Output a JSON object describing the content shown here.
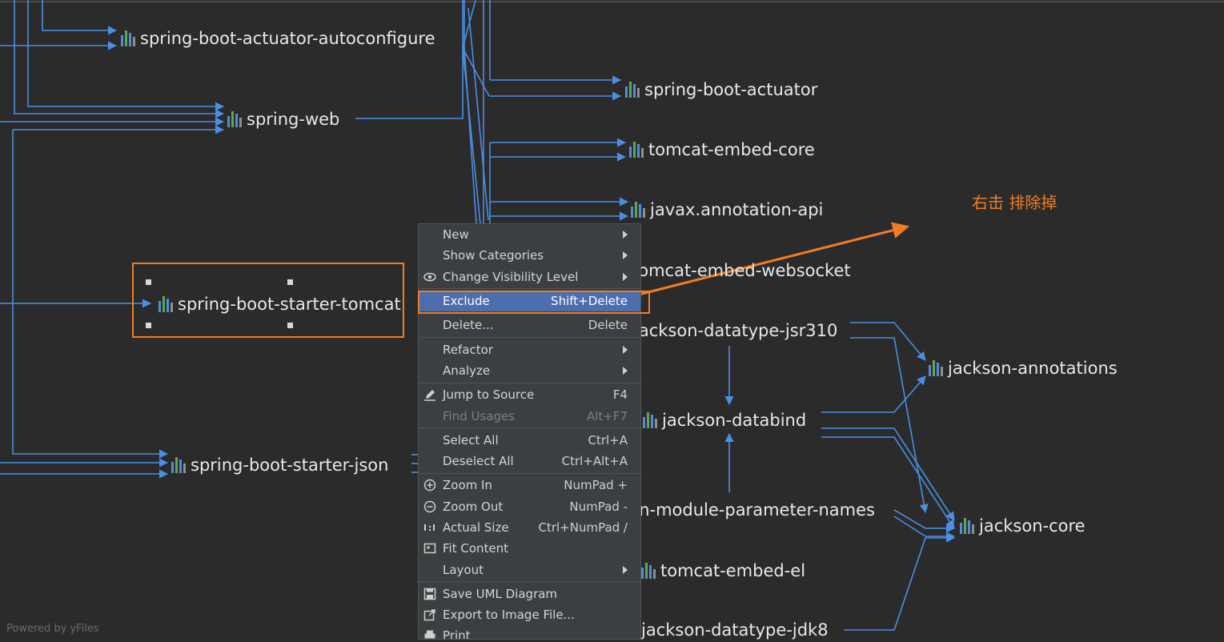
{
  "nodes": [
    {
      "id": "autoconfigure",
      "label": "spring-boot-actuator-autoconfigure"
    },
    {
      "id": "actuator",
      "label": "spring-boot-actuator"
    },
    {
      "id": "spring_web",
      "label": "spring-web"
    },
    {
      "id": "tomcat_core",
      "label": "tomcat-embed-core"
    },
    {
      "id": "javax_annotation",
      "label": "javax.annotation-api"
    },
    {
      "id": "websocket",
      "label": "tomcat-embed-websocket"
    },
    {
      "id": "starter_tomcat",
      "label": "spring-boot-starter-tomcat"
    },
    {
      "id": "jsr310",
      "label": "jackson-datatype-jsr310"
    },
    {
      "id": "jackson_annotations",
      "label": "jackson-annotations"
    },
    {
      "id": "databind",
      "label": "jackson-databind"
    },
    {
      "id": "starter_json",
      "label": "spring-boot-starter-json"
    },
    {
      "id": "param_names",
      "label": "jackson-module-parameter-names"
    },
    {
      "id": "jackson_core",
      "label": "jackson-core"
    },
    {
      "id": "tomcat_el",
      "label": "tomcat-embed-el"
    },
    {
      "id": "jdk8",
      "label": "jackson-datatype-jdk8"
    }
  ],
  "context_menu": {
    "items": [
      {
        "label": "New",
        "shortcut": "",
        "submenu": true
      },
      {
        "label": "Show Categories",
        "shortcut": "",
        "submenu": true
      },
      {
        "label": "Change Visibility Level",
        "shortcut": "",
        "submenu": true,
        "icon": "eye-icon"
      },
      {
        "label": "Exclude",
        "shortcut": "Shift+Delete",
        "active": true
      },
      {
        "label": "Delete...",
        "shortcut": "Delete"
      },
      {
        "label": "Refactor",
        "shortcut": "",
        "submenu": true
      },
      {
        "label": "Analyze",
        "shortcut": "",
        "submenu": true
      },
      {
        "label": "Jump to Source",
        "shortcut": "F4",
        "icon": "pencil-icon"
      },
      {
        "label": "Find Usages",
        "shortcut": "Alt+F7",
        "disabled": true
      },
      {
        "label": "Select All",
        "shortcut": "Ctrl+A"
      },
      {
        "label": "Deselect All",
        "shortcut": "Ctrl+Alt+A"
      },
      {
        "label": "Zoom In",
        "shortcut": "NumPad +",
        "icon": "zoom-in-icon"
      },
      {
        "label": "Zoom Out",
        "shortcut": "NumPad -",
        "icon": "zoom-out-icon"
      },
      {
        "label": "Actual Size",
        "shortcut": "Ctrl+NumPad /",
        "icon": "actual-size-icon"
      },
      {
        "label": "Fit Content",
        "shortcut": "",
        "icon": "fit-content-icon"
      },
      {
        "label": "Layout",
        "shortcut": "",
        "submenu": true
      },
      {
        "label": "Save UML Diagram",
        "shortcut": "",
        "icon": "save-icon"
      },
      {
        "label": "Export to Image File...",
        "shortcut": "",
        "icon": "export-icon"
      },
      {
        "label": "Print",
        "shortcut": "",
        "icon": "print-icon"
      }
    ]
  },
  "annotation": {
    "text": "右击 排除掉"
  },
  "footer": {
    "text": "Powered by yFiles"
  },
  "colors": {
    "edge": "#4a8fe4",
    "highlight": "#ef7d25",
    "menu_active": "#4b6eaf"
  }
}
